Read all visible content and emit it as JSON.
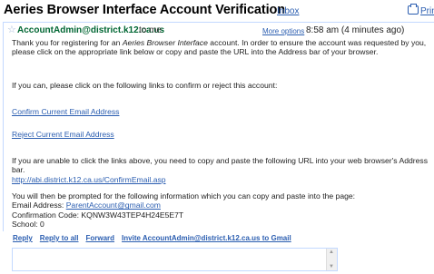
{
  "header": {
    "subject": "Aeries Browser Interface Account Verification",
    "label_tag": "Inbox",
    "print_label": "Prin",
    "print_icon": "printer-icon"
  },
  "message": {
    "star_icon": "star-icon",
    "sender": "AccountAdmin@district.k12.ca.us",
    "recipient": "to me",
    "more_options": "More options",
    "timestamp": "8:58 am (4 minutes ago)"
  },
  "body": {
    "p1_pre": "Thank you for registering for an ",
    "p1_em": "Aeries Browser Interface",
    "p1_post": " account. In order to ensure the account was requested by you, please click on the appropriate link below or copy and paste the URL into the Address bar of your browser.",
    "p2": "If you can, please click on the following links to confirm or reject this account:",
    "confirm_link": "Confirm Current Email Address",
    "reject_link": "Reject Current Email Address",
    "p5": "If you are unable to click the links above, you need to copy and paste the following URL into your web browser's Address bar.",
    "url": "http://abi.district.k12.ca.us/ConfirmEmail.asp",
    "p6": "You will then be prompted for the following information which you can copy and paste into the page:",
    "email_label": "Email Address: ",
    "email_value": "ParentAccount@gmail.com",
    "code_line": "Confirmation Code: KQNW3W43TEP4H24E5E7T",
    "school_line": "School: 0"
  },
  "actions": {
    "reply": "Reply",
    "reply_all": "Reply to all",
    "forward": "Forward",
    "invite": "Invite AccountAdmin@district.k12.ca.us to Gmail"
  },
  "reply_box": {
    "value": ""
  }
}
